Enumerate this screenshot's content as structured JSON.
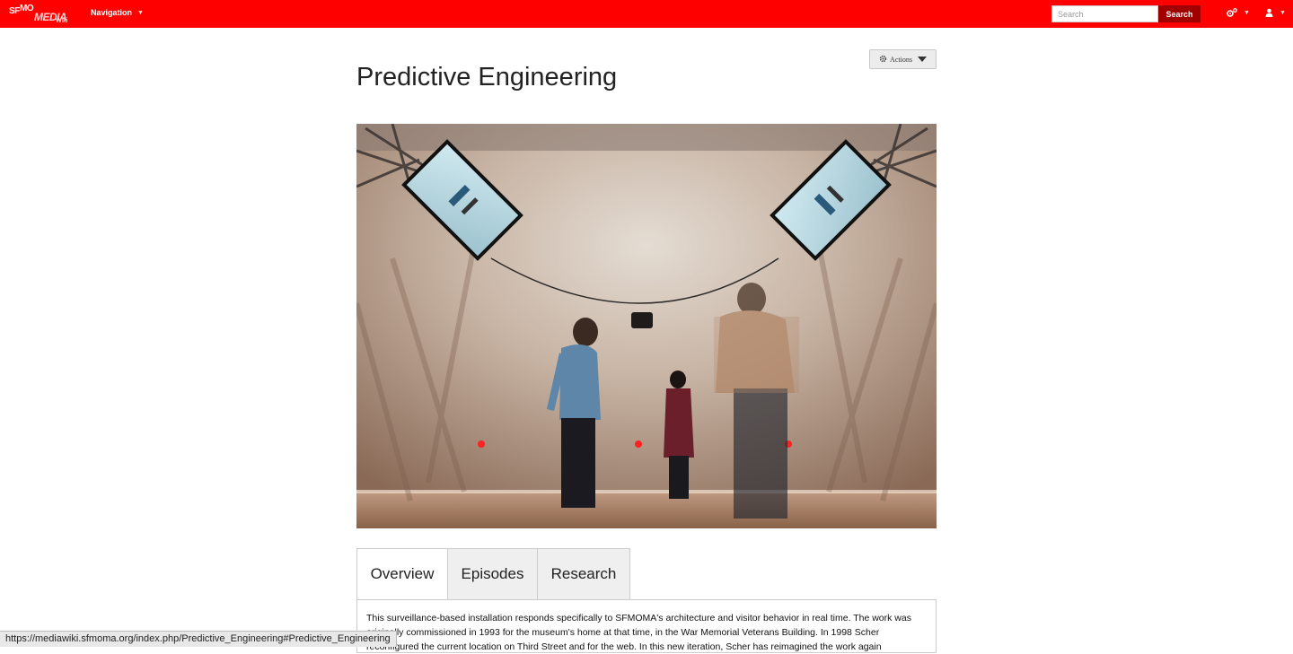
{
  "navbar": {
    "logo": {
      "line1": "SF",
      "line2": "MO",
      "line3": "MEDIA",
      "line4": "Wiki"
    },
    "navigation_label": "Navigation",
    "search_placeholder": "Search",
    "search_button": "Search",
    "colors": {
      "bar": "#ff0000",
      "search_button": "#a00000"
    },
    "icons": [
      "gears-icon",
      "user-icon"
    ]
  },
  "page": {
    "title": "Predictive Engineering",
    "actions_label": "Actions",
    "hero_alt": "Installation view of Predictive Engineering"
  },
  "tabs": [
    {
      "label": "Overview",
      "active": true
    },
    {
      "label": "Episodes",
      "active": false
    },
    {
      "label": "Research",
      "active": false
    }
  ],
  "content": {
    "paragraph": "This surveillance-based installation responds specifically to SFMOMA's architecture and visitor behavior in real time. The work was originally commissioned in 1993 for the museum's home at that time, in the War Memorial Veterans Building. In 1998 Scher reconfigured the current location on Third Street and for the web. In this new iteration, Scher has reimagined the work again"
  },
  "status_bar": {
    "url": "https://mediawiki.sfmoma.org/index.php/Predictive_Engineering#Predictive_Engineering"
  }
}
